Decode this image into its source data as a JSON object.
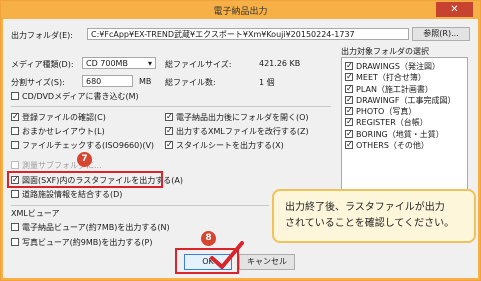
{
  "window": {
    "title": "電子納品出力",
    "close_glyph": "✕"
  },
  "output_folder": {
    "label": "出力フォルダ(E):",
    "value": "C:¥FcApp¥EX-TREND武蔵¥エクスポート¥Xm¥Kouji¥20150224-1737",
    "browse_button": "参照(R)..."
  },
  "media": {
    "type_label": "メディア種類(D):",
    "type_value": "CD 700MB",
    "total_size_label": "総ファイルサイズ:",
    "total_size_value": "421.26 KB",
    "split_label": "分割サイズ(S):",
    "split_value": "680",
    "split_unit": "MB",
    "file_count_label": "総ファイル数:",
    "file_count_value": "1 個",
    "direct_write": "CD/DVDメディアに書き込む(M)"
  },
  "options": {
    "confirm_files": "登録ファイルの確認(C)",
    "auto_layout": "おまかせレイアウト(L)",
    "file_check": "ファイルチェックする(ISO9660)(V)",
    "open_folder": "電子納品出力後にフォルダを開く(O)",
    "xml_newline": "出力するXMLファイルを改行する(Z)",
    "stylesheet": "スタイルシートを出力する(X)",
    "hidden_row": "測量サブフォルダに...",
    "raster_output": "図面(SXF)内のラスタファイルを出力する(A)",
    "road_info": "道路施設情報を結合する(D)"
  },
  "xml_viewer": {
    "group_label": "XMLビューア",
    "electronic": "電子納品ビューア(約7MB)を出力する(N)",
    "photo": "写真ビューア(約9MB)を出力する(P)"
  },
  "folder_select": {
    "label": "出力対象フォルダの選択",
    "items": [
      "DRAWINGS（発注図）",
      "MEET（打合せ簿）",
      "PLAN（施工計画書）",
      "DRAWINGF（工事完成図）",
      "PHOTO（写真）",
      "REGISTER（台帳）",
      "BORING（地質・土質）",
      "OTHERS（その他）"
    ]
  },
  "buttons": {
    "ok": "OK",
    "cancel": "キャンセル"
  },
  "annotations": {
    "step7": "7",
    "step8": "8",
    "callout_line1": "出力終了後、ラスタファイルが出力",
    "callout_line2": "されていることを確認してください。"
  },
  "colors": {
    "titlebar": "#f7b046",
    "highlight": "#d9242b",
    "badge": "#d5452f",
    "callout_bg": "#fdf6db",
    "callout_border": "#efc25a"
  }
}
